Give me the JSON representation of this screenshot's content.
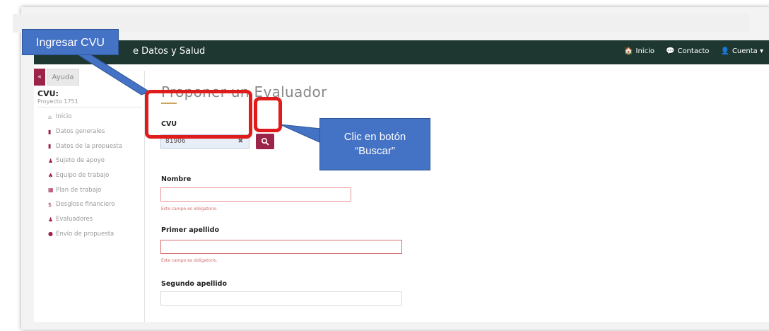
{
  "navbar": {
    "brand": "e Datos y Salud",
    "links": [
      {
        "icon": "home-icon",
        "glyph": "🏠",
        "label": "Inicio"
      },
      {
        "icon": "chat-icon",
        "glyph": "💬",
        "label": "Contacto"
      },
      {
        "icon": "user-icon",
        "glyph": "👤",
        "label": "Cuenta ▾"
      }
    ]
  },
  "sidebar": {
    "toggle": "«",
    "help_label": "Ayuda",
    "cvu_title": "CVU:",
    "project": "Proyecto 1751",
    "items": [
      {
        "label": "Inicio",
        "icon": "home-icon"
      },
      {
        "label": "Datos generales",
        "icon": "file-icon"
      },
      {
        "label": "Datos de la propuesta",
        "icon": "file-icon"
      },
      {
        "label": "Sujeto de apoyo",
        "icon": "user-icon"
      },
      {
        "label": "Equipo de trabajo",
        "icon": "group-icon"
      },
      {
        "label": "Plan de trabajo",
        "icon": "calendar-icon"
      },
      {
        "label": "Desglose financiero",
        "icon": "dollar-icon"
      },
      {
        "label": "Evaluadores",
        "icon": "user-edit-icon"
      },
      {
        "label": "Envío de propuesta",
        "icon": "check-circle-icon"
      }
    ]
  },
  "form": {
    "title": "Proponer un Evaluador",
    "cvu_label": "CVU",
    "cvu_value": "81906",
    "clear_glyph": "✖",
    "search_glyph": "🔍",
    "nombre_label": "Nombre",
    "nombre_error": "Este campo es obligatorio.",
    "primer_label": "Primer apellido",
    "primer_error": "Este campo es obligatorio.",
    "segundo_label": "Segundo apellido"
  },
  "annotations": {
    "callout_1": "Ingresar CVU",
    "callout_2_line1": "Clic en botón",
    "callout_2_line2": "“Buscar”",
    "callout_color": "#4472c4",
    "highlight_color": "#e01b1b"
  },
  "colors": {
    "navbar": "#1e3731",
    "accent": "#9d2449",
    "gold": "#c8a65a"
  }
}
